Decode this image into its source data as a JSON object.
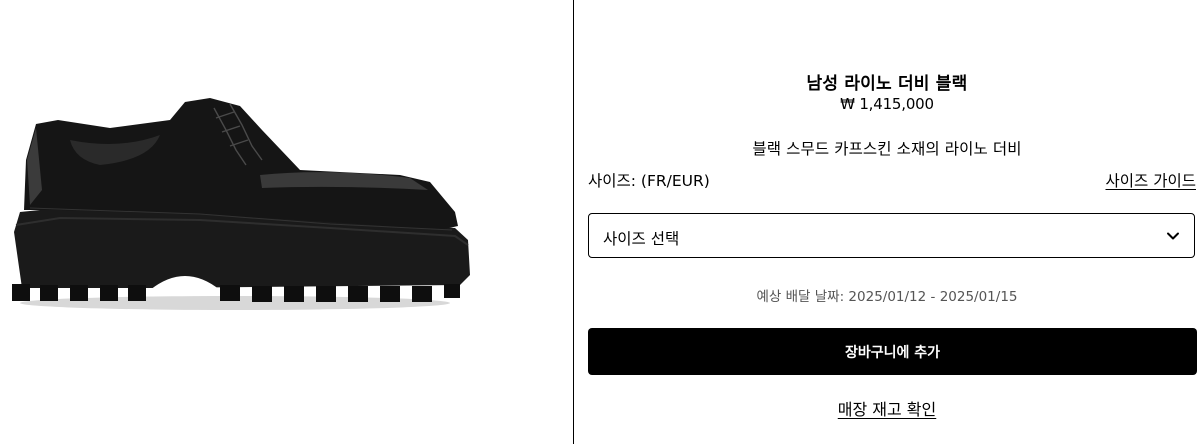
{
  "product": {
    "title": "남성 라이노 더비 블랙",
    "price": "₩ 1,415,000",
    "description": "블랙 스무드 카프스킨 소재의 라이노 더비"
  },
  "size": {
    "label": "사이즈: (FR/EUR)",
    "guide_link": "사이즈 가이드",
    "select_value": "사이즈 선택"
  },
  "delivery_text": "예상 배달 날짜: 2025/01/12 - 2025/01/15",
  "actions": {
    "add_to_cart": "장바구니에 추가",
    "check_store_stock": "매장 재고 확인"
  },
  "icons": {
    "select_chevron": "chevron-down-icon"
  },
  "colors": {
    "primary_button_bg": "#000000",
    "primary_button_text": "#ffffff",
    "muted_text": "#555555"
  }
}
